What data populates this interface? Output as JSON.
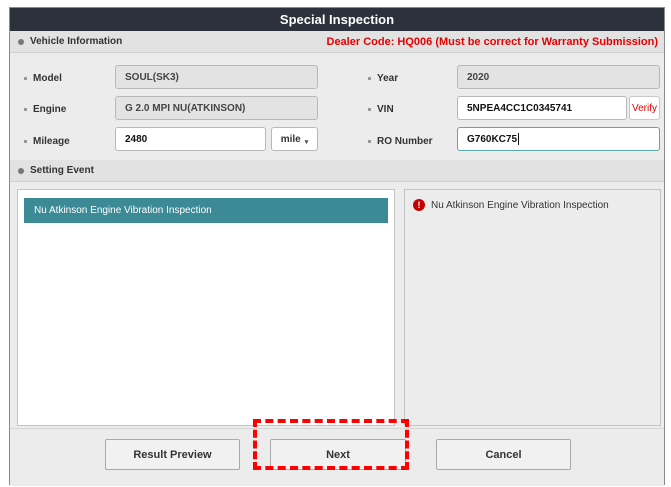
{
  "window": {
    "title": "Special Inspection"
  },
  "vehicle_info": {
    "heading": "Vehicle Information",
    "dealer_code_notice": "Dealer Code: HQ006  (Must be correct for Warranty Submission)",
    "fields": {
      "model": {
        "label": "Model",
        "value": "SOUL(SK3)"
      },
      "engine": {
        "label": "Engine",
        "value": "G 2.0 MPI NU(ATKINSON)"
      },
      "mileage": {
        "label": "Mileage",
        "value": "2480",
        "unit": "mile"
      },
      "year": {
        "label": "Year",
        "value": "2020"
      },
      "vin": {
        "label": "VIN",
        "value": "5NPEA4CC1C0345741",
        "verify_label": "Verify"
      },
      "ro_number": {
        "label": "RO Number",
        "value": "G760KC75"
      }
    }
  },
  "setting_event": {
    "heading": "Setting Event",
    "items": [
      "Nu Atkinson Engine Vibration Inspection"
    ],
    "selected_index": 0,
    "detail_text": "Nu Atkinson Engine Vibration Inspection",
    "detail_icon": "alert-icon"
  },
  "footer": {
    "result_preview_label": "Result Preview",
    "next_label": "Next",
    "cancel_label": "Cancel"
  },
  "colors": {
    "titlebar": "#2c313c",
    "accent_selected": "#3b8a96",
    "dealer_text": "#e60000",
    "highlight_box": "#ff0000"
  }
}
